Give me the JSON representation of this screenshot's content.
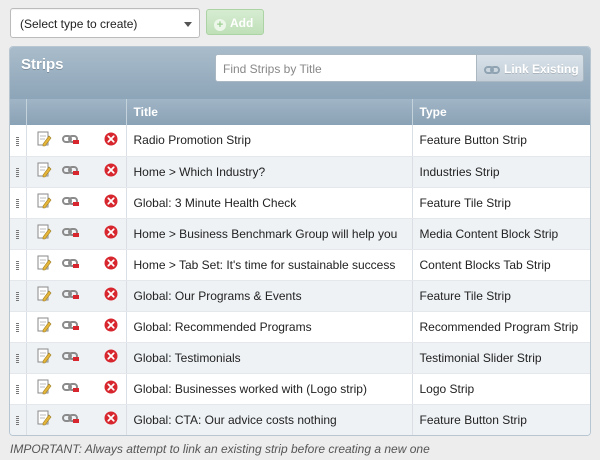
{
  "toolbar": {
    "type_select_value": "(Select type to create)",
    "add_label": "Add"
  },
  "panel": {
    "title": "Strips",
    "search_placeholder": "Find Strips by Title",
    "link_existing_label": "Link Existing"
  },
  "table": {
    "columns": [
      "Title",
      "Type"
    ],
    "rows": [
      {
        "title": "Radio Promotion Strip",
        "type": "Feature Button Strip"
      },
      {
        "title": "Home > Which Industry?",
        "type": "Industries Strip"
      },
      {
        "title": "Global: 3 Minute Health Check",
        "type": "Feature Tile Strip"
      },
      {
        "title": "Home > Business Benchmark Group will help you",
        "type": "Media Content Block Strip"
      },
      {
        "title": "Home > Tab Set: It's time for sustainable success",
        "type": "Content Blocks Tab Strip"
      },
      {
        "title": "Global: Our Programs & Events",
        "type": "Feature Tile Strip"
      },
      {
        "title": "Global: Recommended Programs",
        "type": "Recommended Program Strip"
      },
      {
        "title": "Global: Testimonials",
        "type": "Testimonial Slider Strip"
      },
      {
        "title": "Global: Businesses worked with (Logo strip)",
        "type": "Logo Strip"
      },
      {
        "title": "Global: CTA: Our advice costs nothing",
        "type": "Feature Button Strip"
      }
    ]
  },
  "footer_note": "IMPORTANT: Always attempt to link an existing strip before creating a new one",
  "icons": {
    "row_handle": "drag-handle-icon",
    "edit": "edit-icon",
    "link": "link-icon",
    "delete": "delete-icon"
  },
  "colors": {
    "header_blue": "#8da5b8",
    "add_green": "#bfe0b8",
    "delete_red": "#d7262d"
  }
}
